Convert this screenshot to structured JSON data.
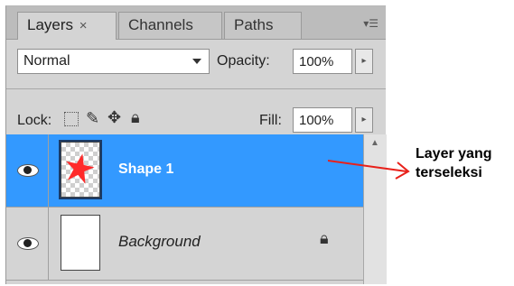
{
  "tabs": [
    {
      "label": "Layers",
      "close": "×",
      "active": true
    },
    {
      "label": "Channels",
      "active": false
    },
    {
      "label": "Paths",
      "active": false
    }
  ],
  "panel_menu_icon": "panel-menu-icon",
  "blend_mode": "Normal",
  "opacity_label": "Opacity:",
  "opacity_value": "100%",
  "lock_label": "Lock:",
  "fill_label": "Fill:",
  "fill_value": "100%",
  "layers": [
    {
      "name": "Shape 1",
      "selected": true,
      "thumb": "red-star-on-transparent"
    },
    {
      "name": "Background",
      "selected": false,
      "thumb": "white",
      "locked": true
    }
  ],
  "annotation": {
    "line1": "Layer yang",
    "line2": "terseleksi",
    "color": "#ff0000"
  },
  "colors": {
    "selection": "#3399ff",
    "arrow": "#e8201a",
    "star": "#ff2a2a"
  }
}
